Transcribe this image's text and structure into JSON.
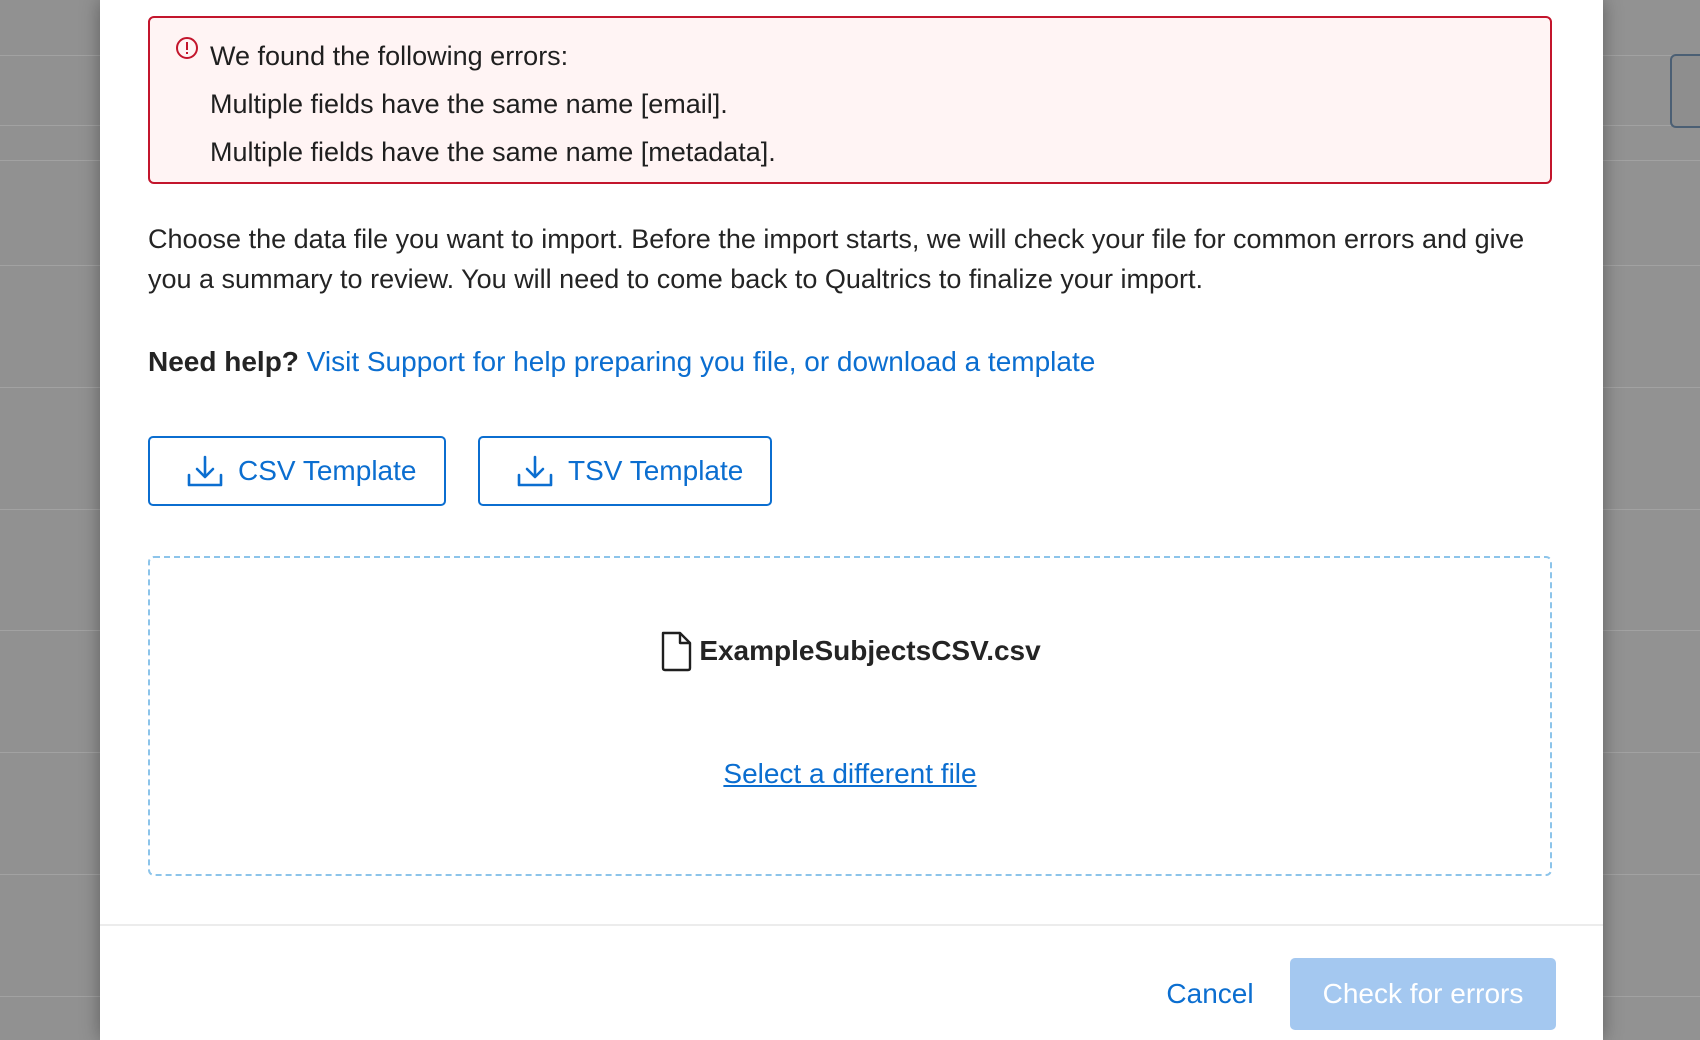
{
  "errors": {
    "heading": "We found the following errors:",
    "items": [
      "Multiple fields have the same name [email].",
      "Multiple fields have the same name [metadata]."
    ],
    "icon": "alert-circle-icon",
    "color": "#c3152c",
    "background": "#fff4f4"
  },
  "intro": {
    "text": "Choose the data file you want to import. Before the import starts, we will check your file for common errors and give you a summary to review. You will need to come back to Qualtrics to finalize your import."
  },
  "help": {
    "label": "Need help?",
    "link": "Visit Support for help preparing you file, or download a template"
  },
  "templates": [
    {
      "label": "CSV Template",
      "icon": "download-icon"
    },
    {
      "label": "TSV Template",
      "icon": "download-icon"
    }
  ],
  "dropzone": {
    "file_name": "ExampleSubjectsCSV.csv",
    "file_icon": "file-icon",
    "select_link": "Select a different file"
  },
  "footer": {
    "cancel_label": "Cancel",
    "check_label": "Check for errors",
    "check_disabled": true
  },
  "colors": {
    "accent": "#0b6ed0",
    "disabled_button": "#a4c8f0",
    "dropzone_border": "#8cc4ea"
  }
}
